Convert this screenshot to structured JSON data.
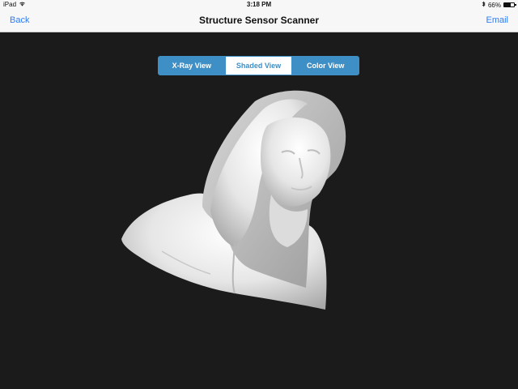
{
  "status_bar": {
    "device": "iPad",
    "time": "3:18 PM",
    "battery_percent": "66%",
    "battery_level": 0.66,
    "icons": [
      "wifi-icon",
      "bluetooth-icon",
      "battery-icon"
    ]
  },
  "nav_bar": {
    "back_label": "Back",
    "title": "Structure Sensor Scanner",
    "email_label": "Email",
    "accent_color": "#2e7cf6"
  },
  "view_selector": {
    "options": [
      "X-Ray View",
      "Shaded View",
      "Color View"
    ],
    "selected": "Shaded View",
    "color": "#3e8fc6"
  },
  "viewport": {
    "background": "#1b1b1b",
    "content": "shaded-3d-scan-model"
  }
}
